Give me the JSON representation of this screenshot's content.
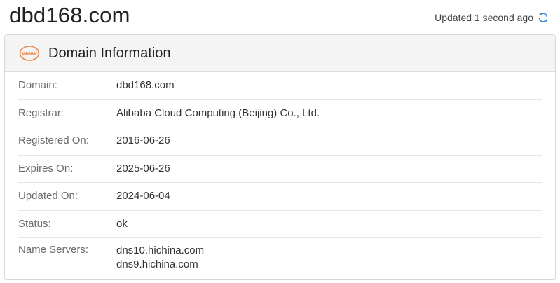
{
  "domain": "dbd168.com",
  "updated": "Updated 1 second ago",
  "icons": {
    "refresh": "refresh-icon",
    "www": "www-icon"
  },
  "colors": {
    "accent_orange": "#e8894a",
    "refresh_blue": "#3b8ed6"
  },
  "card": {
    "title": "Domain Information",
    "www_badge": "www",
    "rows": [
      {
        "label": "Domain:",
        "value": "dbd168.com"
      },
      {
        "label": "Registrar:",
        "value": "Alibaba Cloud Computing (Beijing) Co., Ltd."
      },
      {
        "label": "Registered On:",
        "value": "2016-06-26"
      },
      {
        "label": "Expires On:",
        "value": "2025-06-26"
      },
      {
        "label": "Updated On:",
        "value": "2024-06-04"
      },
      {
        "label": "Status:",
        "value": "ok"
      }
    ],
    "name_servers": {
      "label": "Name Servers:",
      "values": [
        "dns10.hichina.com",
        "dns9.hichina.com"
      ]
    }
  }
}
